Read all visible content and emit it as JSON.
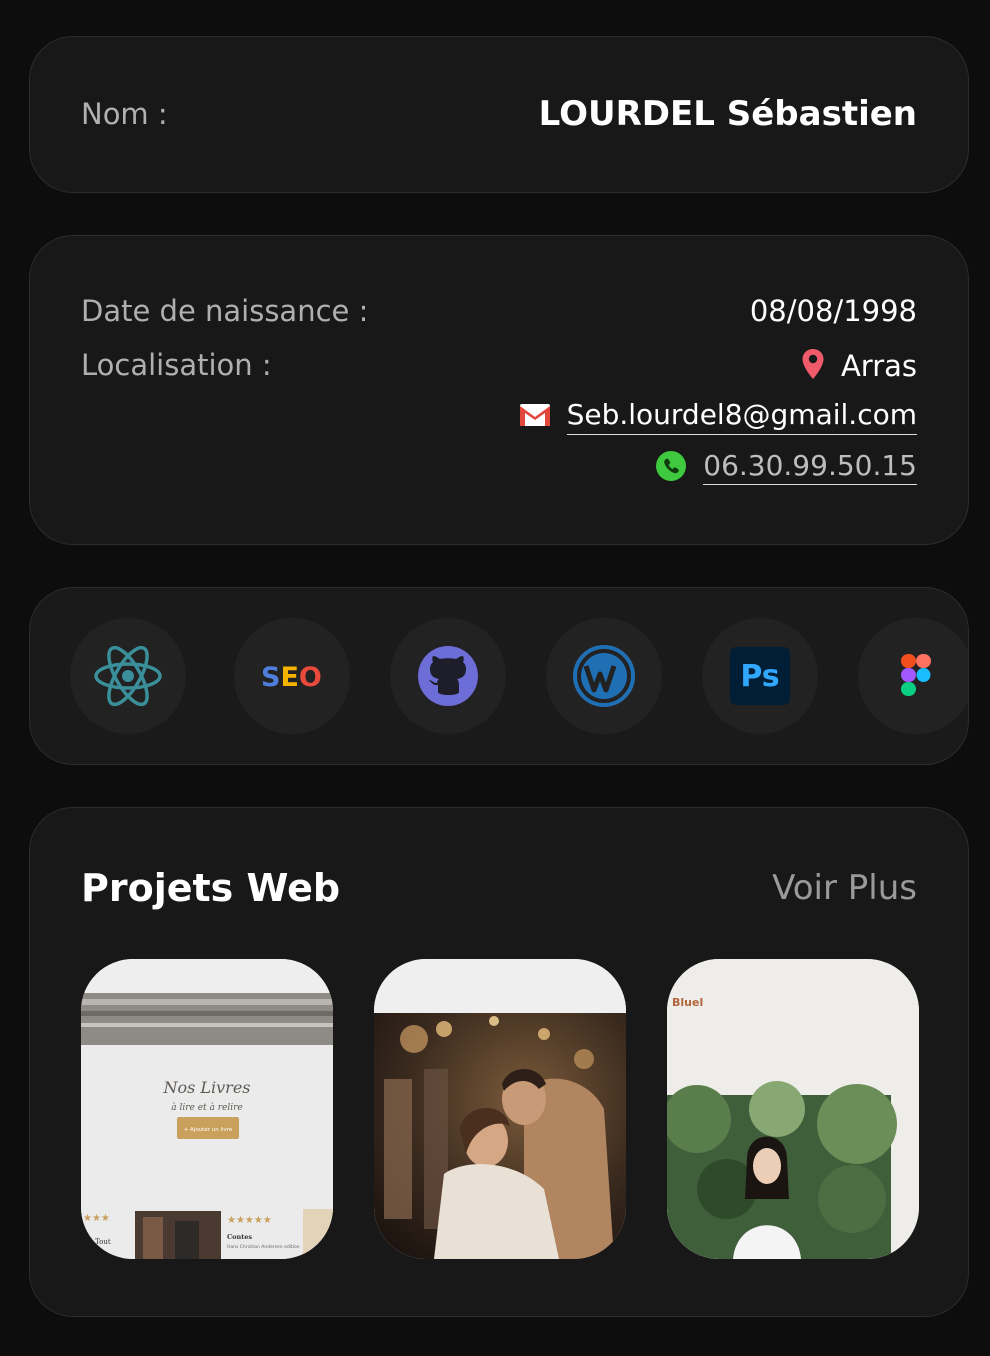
{
  "profile": {
    "name_label": "Nom :",
    "name_value": "LOURDEL Sébastien"
  },
  "info": {
    "birth_label": "Date de naissance :",
    "birth_value": "08/08/1998",
    "location_label": "Localisation :",
    "location_value": "Arras",
    "email": "Seb.lourdel8@gmail.com",
    "phone": "06.30.99.50.15"
  },
  "skills": {
    "items": [
      {
        "name": "react-icon"
      },
      {
        "name": "seo-icon",
        "text": "SEO"
      },
      {
        "name": "github-icon"
      },
      {
        "name": "wordpress-icon"
      },
      {
        "name": "photoshop-icon",
        "text": "Ps"
      },
      {
        "name": "figma-icon"
      }
    ]
  },
  "projects": {
    "title": "Projets Web",
    "more_label": "Voir Plus",
    "items": [
      {
        "name": "project-nos-livres",
        "heading": "Nos Livres",
        "subheading": "à lire et à relire",
        "button": "+ Ajouter un livre",
        "book1": "Tout",
        "book2": "Contes",
        "book2_sub": "Hans Christian Andersen edition"
      },
      {
        "name": "project-wedding-photo"
      },
      {
        "name": "project-bluel",
        "brand": "Bluel"
      }
    ]
  },
  "colors": {
    "background": "#0d0d0d",
    "card": "#181818",
    "react": "#3a8f9a",
    "github": "#6c6dd6",
    "wordpress": "#1f6fb5",
    "photoshop": "#31a8ff",
    "location_pin": "#ef5b6b",
    "gmail": "#e3463a",
    "phone": "#3fc93f"
  }
}
